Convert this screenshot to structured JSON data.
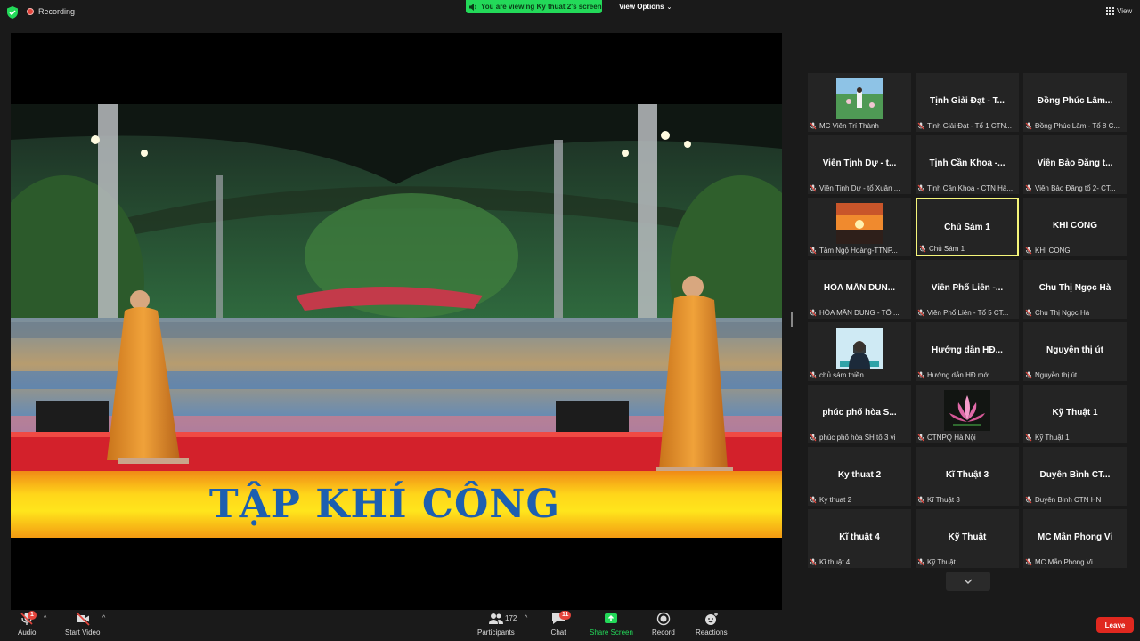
{
  "topbar": {
    "recording_label": "Recording",
    "viewing_banner": "You are viewing Ky thuat 2's screen",
    "view_options_label": "View Options",
    "view_label": "View"
  },
  "share": {
    "slide_title": "TẬP KHÍ CÔNG"
  },
  "gallery": {
    "tiles": [
      {
        "name": "",
        "footer": "MC Viên Trí Thành",
        "thumb": "meadow-photo"
      },
      {
        "name": "Tịnh Giải Đạt - T...",
        "footer": "Tịnh Giải Đạt - Tổ 1 CTN..."
      },
      {
        "name": "Đồng Phúc Lâm...",
        "footer": "Đồng Phúc Lâm - Tổ 8 C..."
      },
      {
        "name": "Viên Tịnh Dự - t...",
        "footer": "Viên Tịnh Dự - tổ Xuân ..."
      },
      {
        "name": "Tịnh Cần Khoa -...",
        "footer": "Tịnh Cần Khoa - CTN Hà..."
      },
      {
        "name": "Viên Bảo Đăng t...",
        "footer": "Viên Bảo Đăng tổ 2- CT..."
      },
      {
        "name": "",
        "footer": "Tâm Ngộ Hoàng-TTNP...",
        "thumb": "sunset-photo"
      },
      {
        "name": "Chủ Sám 1",
        "footer": "Chủ Sám 1",
        "active": true
      },
      {
        "name": "KHÍ CÔNG",
        "footer": "KHÍ CÔNG"
      },
      {
        "name": "HÒA MẪN DUN...",
        "footer": "HÒA MẪN DUNG - TỔ ..."
      },
      {
        "name": "Viên Phổ Liên -...",
        "footer": "Viên Phổ Liên - Tổ 5 CT..."
      },
      {
        "name": "Chu Thị Ngọc Hà",
        "footer": "Chu Thị Ngọc Hà"
      },
      {
        "name": "",
        "footer": "chủ sám thiền",
        "thumb": "person-photo"
      },
      {
        "name": "Hướng dẫn HĐ...",
        "footer": "Hướng dẫn HĐ mới"
      },
      {
        "name": "Nguyễn thị út",
        "footer": "Nguyễn thị út"
      },
      {
        "name": "phúc phổ hòa S...",
        "footer": "phúc phổ hòa SH tổ 3 vi"
      },
      {
        "name": "",
        "footer": "CTNPQ Hà Nội",
        "thumb": "lotus-photo"
      },
      {
        "name": "Kỹ Thuật 1",
        "footer": "Kỹ Thuật 1"
      },
      {
        "name": "Ky thuat 2",
        "footer": "Ky thuat 2"
      },
      {
        "name": "Kĩ Thuật 3",
        "footer": "Kĩ Thuật 3"
      },
      {
        "name": "Duyên Bình  CT...",
        "footer": "Duyên Bình  CTN HN"
      },
      {
        "name": "Kĩ thuật 4",
        "footer": "Kĩ thuật 4"
      },
      {
        "name": "Kỹ Thuật",
        "footer": "Kỹ Thuật"
      },
      {
        "name": "MC Mẫn Phong Vi",
        "footer": "MC Mẫn Phong Vi"
      }
    ]
  },
  "toolbar": {
    "audio_label": "Audio",
    "audio_badge": "1",
    "video_label": "Start Video",
    "participants_label": "Participants",
    "participants_count": "172",
    "chat_label": "Chat",
    "chat_badge": "11",
    "share_label": "Share Screen",
    "record_label": "Record",
    "reactions_label": "Reactions",
    "leave_label": "Leave"
  },
  "colors": {
    "share_green": "#23d959",
    "leave_red": "#e0281f",
    "active_speaker": "#f5f57a",
    "slide_text_blue": "#1d5fb0"
  }
}
